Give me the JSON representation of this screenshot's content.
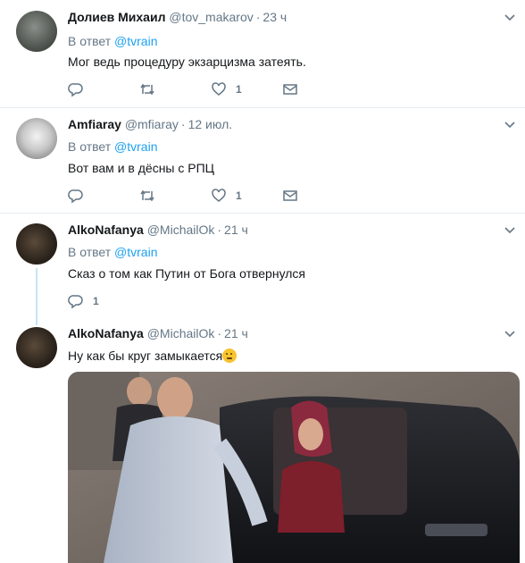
{
  "tweets": [
    {
      "name": "Долиев Михаил",
      "handle": "@tov_makarov",
      "dot": "·",
      "time": "23 ч",
      "reply_prefix": "В ответ",
      "reply_to": "@tvrain",
      "text": "Мог ведь процедуру экзарцизма затеять.",
      "reply_count": "",
      "retweet_count": "",
      "like_count": "1"
    },
    {
      "name": "Amfiaray",
      "handle": "@mfiaray",
      "dot": "·",
      "time": "12 июл.",
      "reply_prefix": "В ответ",
      "reply_to": "@tvrain",
      "text": "Вот вам и в дёсны с РПЦ",
      "reply_count": "",
      "retweet_count": "",
      "like_count": "1"
    },
    {
      "name": "AlkoNafanya",
      "handle": "@MichailOk",
      "dot": "·",
      "time": "21 ч",
      "reply_prefix": "В ответ",
      "reply_to": "@tvrain",
      "text": "Сказ о том как Путин от Бога отвернулся",
      "reply_count": "1",
      "retweet_count": "",
      "like_count": ""
    },
    {
      "name": "AlkoNafanya",
      "handle": "@MichailOk",
      "dot": "·",
      "time": "21 ч",
      "text": "Ну как бы круг замыкается"
    }
  ],
  "icons": {
    "reply": "reply-icon",
    "retweet": "retweet-icon",
    "like": "heart-icon",
    "dm": "envelope-icon",
    "more": "chevron-down-icon",
    "emoji": "thinking-face-emoji"
  },
  "colors": {
    "link": "#1da1f2",
    "secondary": "#657786",
    "text": "#14171a",
    "divider": "#e6ecf0",
    "thread_line": "#c4e4f7"
  }
}
